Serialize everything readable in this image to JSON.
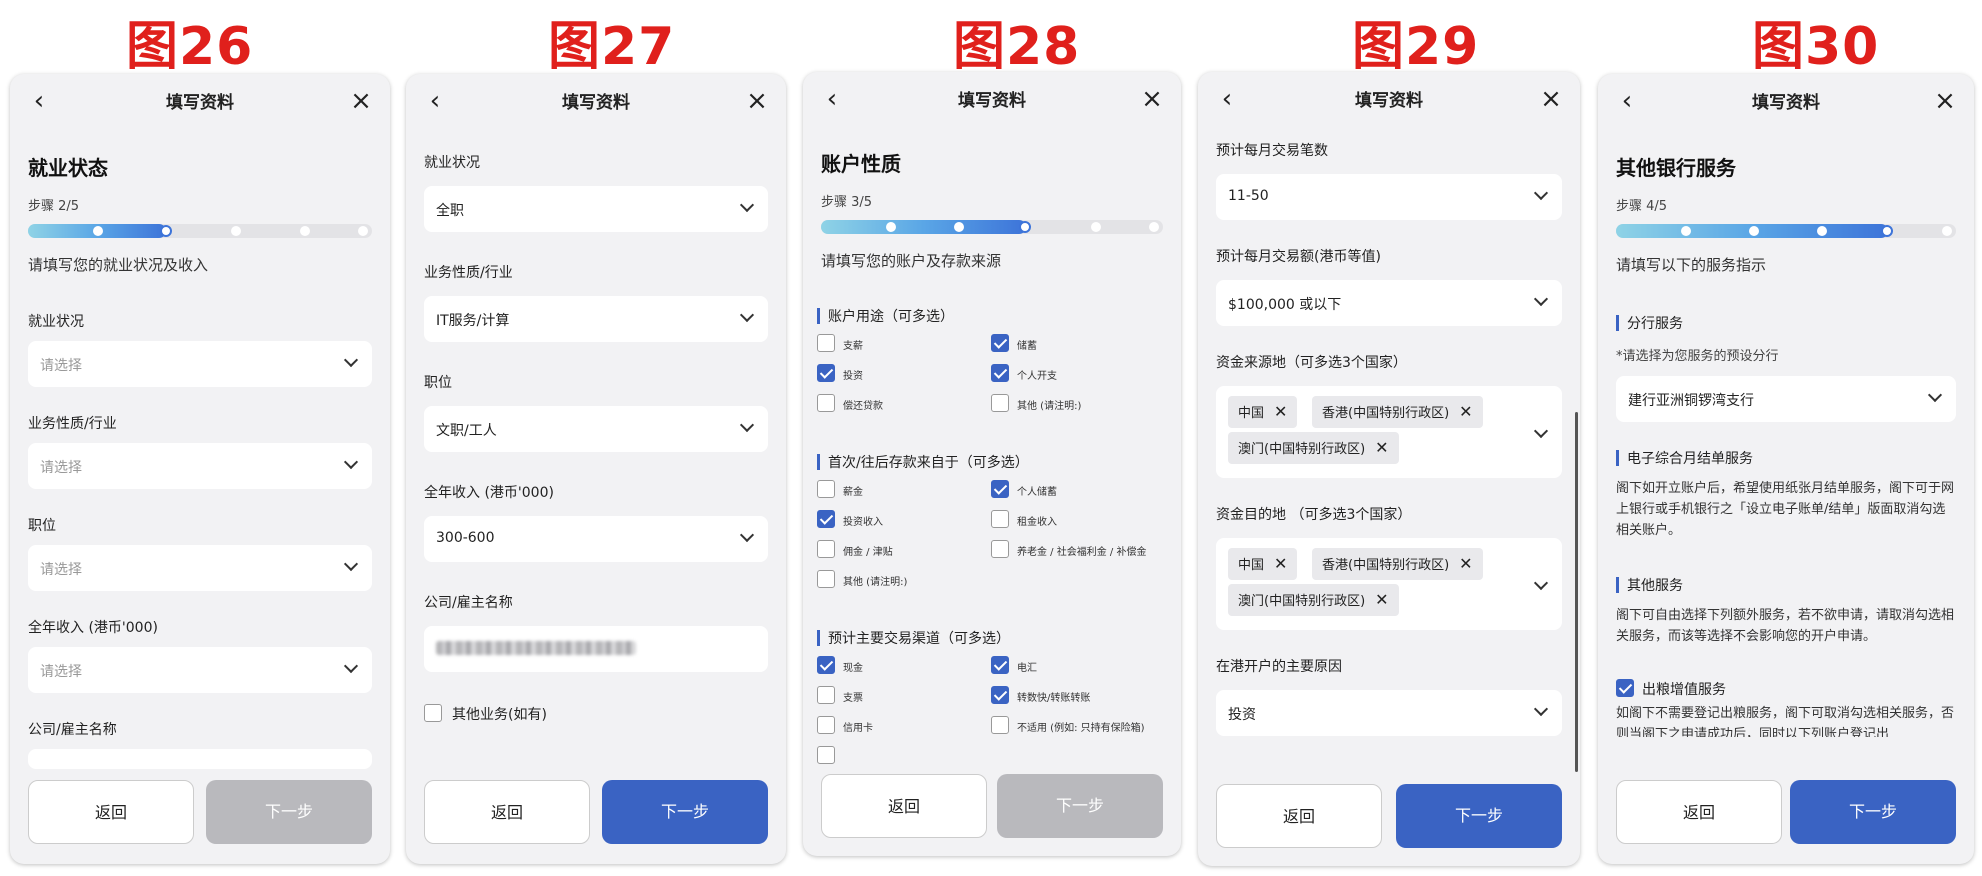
{
  "figures": [
    "图26",
    "图27",
    "图28",
    "图29",
    "图30"
  ],
  "common": {
    "page_title": "填写资料",
    "back_label": "返回",
    "next_label": "下一步"
  },
  "p26": {
    "heading": "就业状态",
    "step": "步骤 2/5",
    "progress": 0.4,
    "subtitle": "请填写您的就业状况及收入",
    "fields": [
      {
        "label": "就业状况",
        "placeholder": "请选择"
      },
      {
        "label": "业务性质/行业",
        "placeholder": "请选择"
      },
      {
        "label": "职位",
        "placeholder": "请选择"
      },
      {
        "label": "全年收入 (港币'000)",
        "placeholder": "请选择"
      },
      {
        "label": "公司/雇主名称",
        "placeholder": ""
      }
    ]
  },
  "p27": {
    "fields": [
      {
        "label": "就业状况",
        "value": "全职"
      },
      {
        "label": "业务性质/行业",
        "value": "IT服务/计算"
      },
      {
        "label": "职位",
        "value": "文职/工人"
      },
      {
        "label": "全年收入 (港币'000)",
        "value": "300-600"
      },
      {
        "label": "公司/雇主名称",
        "value": ""
      }
    ],
    "other_business_label": "其他业务(如有)",
    "other_business_checked": false
  },
  "p28": {
    "heading": "账户性质",
    "step": "步骤 3/5",
    "progress": 0.6,
    "subtitle": "请填写您的账户及存款来源",
    "groups": [
      {
        "title": "账户用途（可多选）",
        "options": [
          {
            "label": "支薪",
            "checked": false
          },
          {
            "label": "储蓄",
            "checked": true
          },
          {
            "label": "投资",
            "checked": true
          },
          {
            "label": "个人开支",
            "checked": true
          },
          {
            "label": "偿还贷款",
            "checked": false
          },
          {
            "label": "其他 (请注明:)",
            "checked": false
          }
        ]
      },
      {
        "title": "首次/往后存款来自于（可多选）",
        "options": [
          {
            "label": "薪金",
            "checked": false
          },
          {
            "label": "个人储蓄",
            "checked": true
          },
          {
            "label": "投资收入",
            "checked": true
          },
          {
            "label": "租金收入",
            "checked": false
          },
          {
            "label": "佣金 / 津贴",
            "checked": false
          },
          {
            "label": "养老金 / 社会福利金 / 补偿金",
            "checked": false
          },
          {
            "label": "其他 (请注明:)",
            "checked": false
          }
        ]
      },
      {
        "title": "预计主要交易渠道（可多选）",
        "options": [
          {
            "label": "现金",
            "checked": true
          },
          {
            "label": "电汇",
            "checked": true
          },
          {
            "label": "支票",
            "checked": false
          },
          {
            "label": "转数快/转账转账",
            "checked": true
          },
          {
            "label": "信用卡",
            "checked": false
          },
          {
            "label": "不适用 (例如: 只持有保险箱)",
            "checked": false
          }
        ]
      }
    ]
  },
  "p29": {
    "f1_label": "预计每月交易笔数",
    "f1_value": "11-50",
    "f2_label": "预计每月交易额(港币等值)",
    "f2_value": "$100,000 或以下",
    "f3_label": "资金来源地（可多选3个国家）",
    "f3_chips": [
      "中国",
      "香港(中国特别行政区)",
      "澳门(中国特别行政区)"
    ],
    "f4_label": "资金目的地 （可多选3个国家）",
    "f4_chips": [
      "中国",
      "香港(中国特别行政区)",
      "澳门(中国特别行政区)"
    ],
    "f5_label": "在港开户的主要原因",
    "f5_value": "投资",
    "chip_remove": "✕"
  },
  "p30": {
    "heading": "其他银行服务",
    "step": "步骤 4/5",
    "progress": 0.8,
    "subtitle": "请填写以下的服务指示",
    "s1_title": "分行服务",
    "s1_note": "*请选择为您服务的预设分行",
    "s1_value": "建行亚洲铜锣湾支行",
    "s2_title": "电子综合月结单服务",
    "s2_text": "阁下如开立账户后，希望使用纸张月结单服务，阁下可于网上银行或手机银行之「设立电子账单/结单」版面取消勾选相关账户。",
    "s3_title": "其他服务",
    "s3_text": "阁下可自由选择下列额外服务，若不欲申请，请取消勾选相关服务，而该等选择不会影响您的开户申请。",
    "s3_option_label": "出粮增值服务",
    "s3_option_checked": true,
    "s3_option_text": "如阁下不需要登记出粮服务，阁下可取消勾选相关服务，否则当阁下之申请成功后，同时以下列账户登记出"
  },
  "colors": {
    "accent": "#3a63c3",
    "figure_label": "#e0201c",
    "disabled": "#b9b9bd"
  }
}
